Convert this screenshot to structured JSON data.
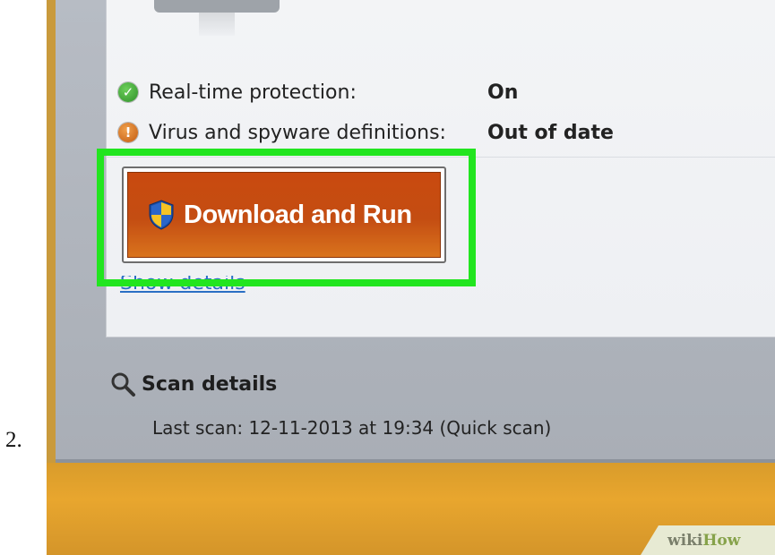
{
  "step": {
    "number": "2."
  },
  "status": {
    "items": [
      {
        "label": "Real-time protection:",
        "value": "On",
        "icon": "check-icon"
      },
      {
        "label": "Virus and spyware definitions:",
        "value": "Out of date",
        "icon": "warning-icon"
      }
    ]
  },
  "action": {
    "download_label": "Download and Run"
  },
  "links": {
    "show_details": "Show details"
  },
  "scan": {
    "title": "Scan details",
    "last_scan": "Last scan: 12-11-2013 at 19:34 (Quick scan)"
  },
  "watermark": {
    "wiki": "wiki",
    "how": "How"
  },
  "colors": {
    "highlight": "#22e51f",
    "button": "#c44d12",
    "link": "#2a6fc4",
    "bottom_bar": "#e8a62e"
  }
}
